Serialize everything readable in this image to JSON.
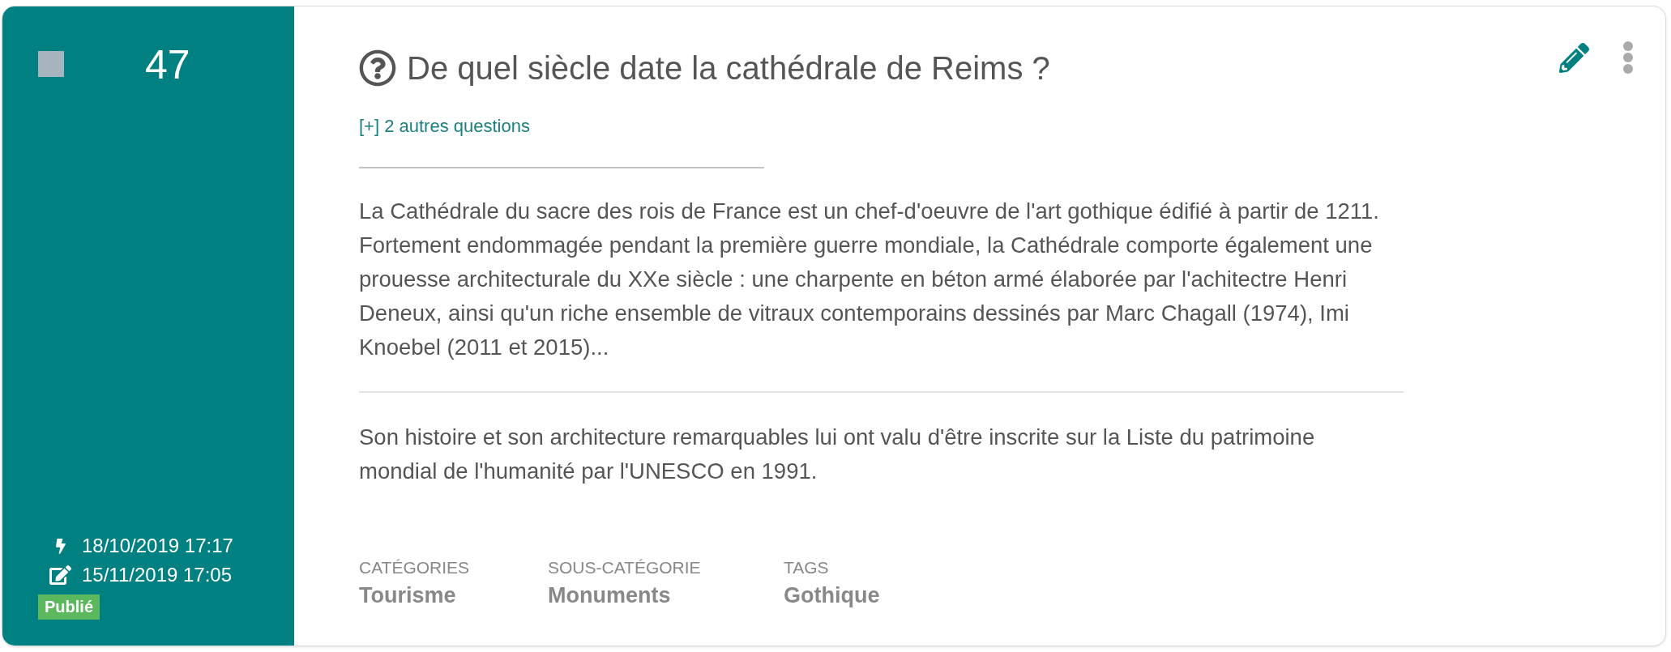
{
  "item": {
    "checked": false,
    "number": "47",
    "dates": [
      {
        "kind": "created",
        "text": "18/10/2019 17:17"
      },
      {
        "kind": "edited",
        "text": "15/11/2019 17:05"
      }
    ],
    "status": "Publié",
    "question": "De quel siècle date la cathédrale de Reims ?",
    "more_questions_link": "[+] 2 autres questions",
    "answer": "La Cathédrale du sacre des rois de France est un chef-d'oeuvre de l'art gothique édifié à partir de 1211. Fortement endommagée pendant la première guerre mondiale, la Cathédrale comporte également une prouesse architecturale du XXe siècle : une charpente en béton armé élaborée par l'achitectre Henri Deneux, ainsi qu'un riche ensemble de vitraux contemporains dessinés par Marc Chagall (1974), Imi Knoebel (2011 et 2015)...",
    "note": "Son histoire et son architecture remarquables lui ont valu d'être inscrite sur la Liste du patrimoine mondial de l'humanité par l'UNESCO en 1991.",
    "meta": [
      {
        "label": "CATÉGORIES",
        "value": "Tourisme"
      },
      {
        "label": "SOUS-CATÉGORIE",
        "value": "Monuments"
      },
      {
        "label": "TAGS",
        "value": "Gothique"
      }
    ]
  }
}
